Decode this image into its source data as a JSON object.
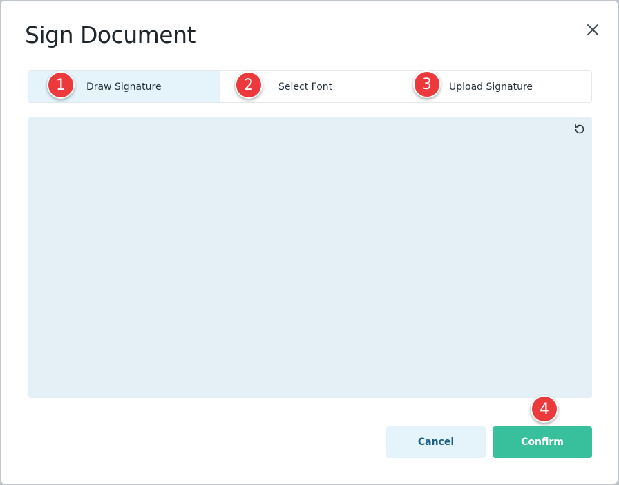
{
  "dialog": {
    "title": "Sign Document"
  },
  "tabs": [
    {
      "label": "Draw Signature",
      "badge": "1",
      "active": true
    },
    {
      "label": "Select Font",
      "badge": "2",
      "active": false
    },
    {
      "label": "Upload Signature",
      "badge": "3",
      "active": false
    }
  ],
  "canvas": {
    "reset_icon": "reset-icon"
  },
  "actions": {
    "cancel_label": "Cancel",
    "confirm_label": "Confirm",
    "confirm_badge": "4"
  },
  "colors": {
    "badge": "#ec3a3c",
    "confirm": "#38c09c",
    "cancel_bg": "#e5f3fa",
    "active_tab": "#e5f4fb",
    "canvas_bg": "#e4eff6"
  }
}
